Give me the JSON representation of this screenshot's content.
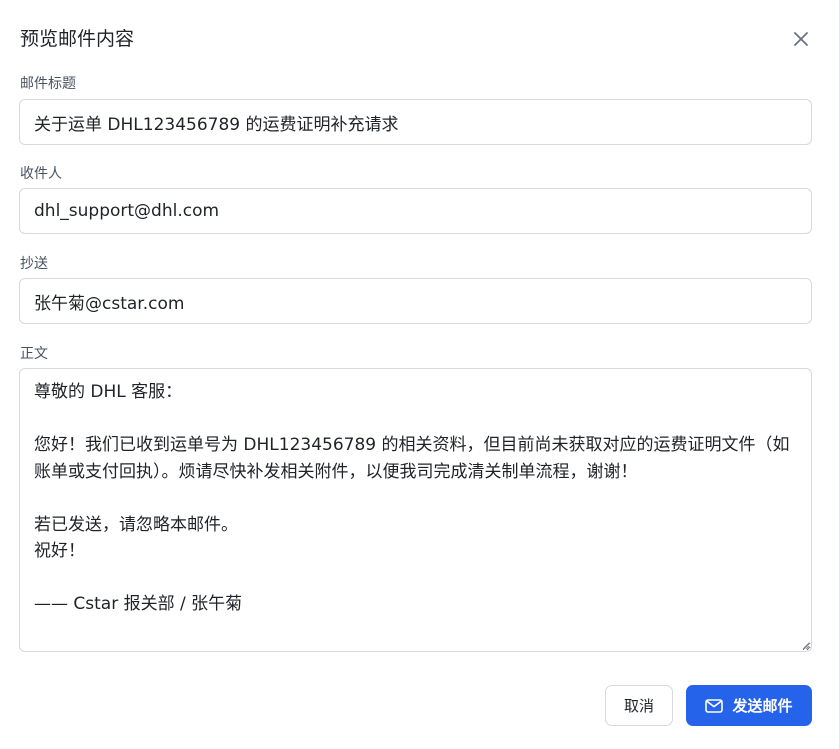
{
  "dialog": {
    "title": "预览邮件内容",
    "close_icon": "close-icon"
  },
  "fields": {
    "subject": {
      "label": "邮件标题",
      "value": "关于运单 DHL123456789 的运费证明补充请求"
    },
    "recipient": {
      "label": "收件人",
      "value": "dhl_support@dhl.com"
    },
    "cc": {
      "label": "抄送",
      "value": "张午菊@cstar.com"
    },
    "body": {
      "label": "正文",
      "value": "尊敬的 DHL 客服：\n\n您好！我们已收到运单号为 DHL123456789 的相关资料，但目前尚未获取对应的运费证明文件（如账单或支付回执）。烦请尽快补发相关附件，以便我司完成清关制单流程，谢谢！\n\n若已发送，请忽略本邮件。\n祝好！\n\n—— Cstar 报关部 / 张午菊"
    }
  },
  "actions": {
    "cancel_label": "取消",
    "send_label": "发送邮件",
    "send_icon": "mail-icon"
  },
  "colors": {
    "primary": "#2563eb",
    "border": "#d5d9e0",
    "label": "#4a5160",
    "text": "#1f2328"
  }
}
